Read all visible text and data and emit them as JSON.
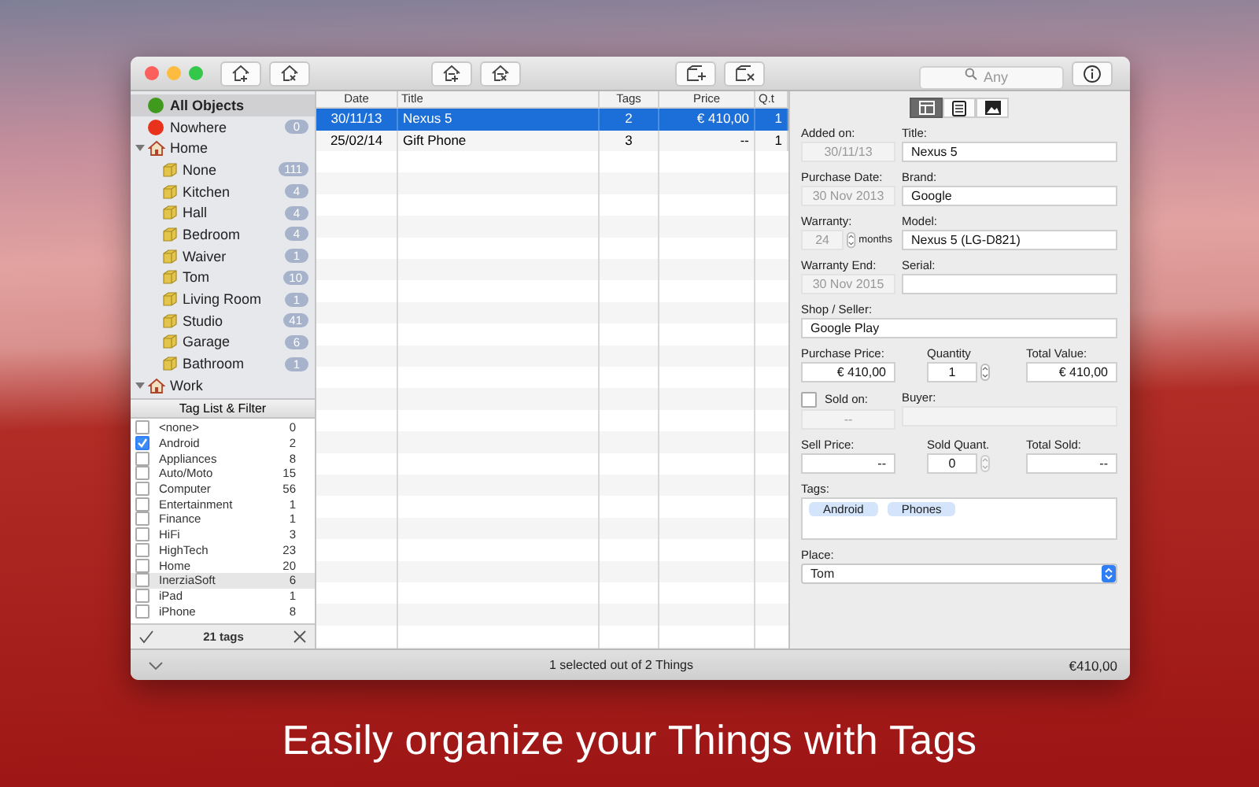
{
  "toolbar": {
    "search": {
      "placeholder": "Any"
    }
  },
  "sidebar": {
    "places": [
      {
        "label": "All Objects",
        "kind": "dot",
        "color": "#3f9a1d",
        "selected": true
      },
      {
        "label": "Nowhere",
        "kind": "dot",
        "color": "#e8321c",
        "count": "0",
        "selected": false
      },
      {
        "label": "Home",
        "kind": "house",
        "expanded": true,
        "selected": false,
        "children": [
          {
            "label": "None",
            "kind": "box",
            "count": "111",
            "selected": false
          },
          {
            "label": "Kitchen",
            "kind": "box",
            "count": "4",
            "selected": false
          },
          {
            "label": "Hall",
            "kind": "box",
            "count": "4",
            "selected": false
          },
          {
            "label": "Bedroom",
            "kind": "box",
            "count": "4",
            "selected": false
          },
          {
            "label": "Waiver",
            "kind": "box",
            "count": "1",
            "selected": false
          },
          {
            "label": "Tom",
            "kind": "box",
            "count": "10",
            "selected": false
          },
          {
            "label": "Living Room",
            "kind": "box",
            "count": "1",
            "selected": false
          },
          {
            "label": "Studio",
            "kind": "box",
            "count": "41",
            "selected": false
          },
          {
            "label": "Garage",
            "kind": "box",
            "count": "6",
            "selected": false
          },
          {
            "label": "Bathroom",
            "kind": "box",
            "count": "1",
            "selected": false
          }
        ]
      },
      {
        "label": "Work",
        "kind": "house",
        "expanded": true,
        "selected": false
      }
    ],
    "tag_filter": {
      "title": "Tag List & Filter",
      "tags": [
        {
          "label": "<none>",
          "count": "0",
          "checked": false,
          "selected": false
        },
        {
          "label": "Android",
          "count": "2",
          "checked": true,
          "selected": false
        },
        {
          "label": "Appliances",
          "count": "8",
          "checked": false,
          "selected": false
        },
        {
          "label": "Auto/Moto",
          "count": "15",
          "checked": false,
          "selected": false
        },
        {
          "label": "Computer",
          "count": "56",
          "checked": false,
          "selected": false
        },
        {
          "label": "Entertainment",
          "count": "1",
          "checked": false,
          "selected": false
        },
        {
          "label": "Finance",
          "count": "1",
          "checked": false,
          "selected": false
        },
        {
          "label": "HiFi",
          "count": "3",
          "checked": false,
          "selected": false
        },
        {
          "label": "HighTech",
          "count": "23",
          "checked": false,
          "selected": false
        },
        {
          "label": "Home",
          "count": "20",
          "checked": false,
          "selected": false
        },
        {
          "label": "InerziaSoft",
          "count": "6",
          "checked": false,
          "selected": true
        },
        {
          "label": "iPad",
          "count": "1",
          "checked": false,
          "selected": false
        },
        {
          "label": "iPhone",
          "count": "8",
          "checked": false,
          "selected": false
        }
      ],
      "footer": "21 tags"
    }
  },
  "table": {
    "columns": [
      "Date",
      "Title",
      "Tags",
      "Price",
      "Q.t"
    ],
    "rows": [
      {
        "cells": [
          "30/11/13",
          "Nexus 5",
          "2",
          "€ 410,00",
          "1"
        ],
        "selected": true
      },
      {
        "cells": [
          "25/02/14",
          "Gift Phone",
          "3",
          "--",
          "1"
        ],
        "selected": false
      }
    ]
  },
  "detail": {
    "segments": [
      {
        "kind": "layout",
        "selected": true
      },
      {
        "kind": "document",
        "selected": false
      },
      {
        "kind": "picture",
        "selected": false
      }
    ],
    "added_on": {
      "label": "Added on:",
      "value": "30/11/13",
      "disabled": true
    },
    "title": {
      "label": "Title:",
      "value": "Nexus 5",
      "disabled": false
    },
    "purchase_date": {
      "label": "Purchase Date:",
      "value": "30 Nov 2013",
      "disabled": true
    },
    "brand": {
      "label": "Brand:",
      "value": "Google",
      "disabled": false
    },
    "warranty": {
      "label": "Warranty:",
      "value": "24",
      "unit": "months",
      "disabled": true
    },
    "model": {
      "label": "Model:",
      "value": "Nexus 5 (LG-D821)",
      "disabled": false
    },
    "warranty_end": {
      "label": "Warranty End:",
      "value": "30 Nov 2015",
      "disabled": true
    },
    "serial": {
      "label": "Serial:",
      "disabled": false
    },
    "shop": {
      "label": "Shop / Seller:",
      "value": "Google Play",
      "disabled": false
    },
    "purchase_price": {
      "label": "Purchase Price:",
      "value": "€ 410,00",
      "disabled": false
    },
    "quantity": {
      "label": "Quantity",
      "value": "1",
      "disabled": false
    },
    "total_value": {
      "label": "Total Value:",
      "value": "€ 410,00",
      "disabled": false
    },
    "sold_on": {
      "label": "Sold on:",
      "checked": false,
      "value": "--",
      "disabled": true
    },
    "buyer": {
      "label": "Buyer:",
      "disabled": true
    },
    "sell_price": {
      "label": "Sell Price:",
      "value": "--",
      "disabled": false
    },
    "sold_quant": {
      "label": "Sold Quant.",
      "value": "0",
      "disabled": false
    },
    "total_sold": {
      "label": "Total Sold:",
      "value": "--",
      "disabled": false
    },
    "tags": {
      "label": "Tags:",
      "items": [
        "Android",
        "Phones"
      ]
    },
    "place": {
      "label": "Place:",
      "value": "Tom"
    }
  },
  "status_bar": {
    "text": "1 selected out of 2 Things",
    "total": "€410,00"
  },
  "caption": "Easily organize your Things with Tags"
}
